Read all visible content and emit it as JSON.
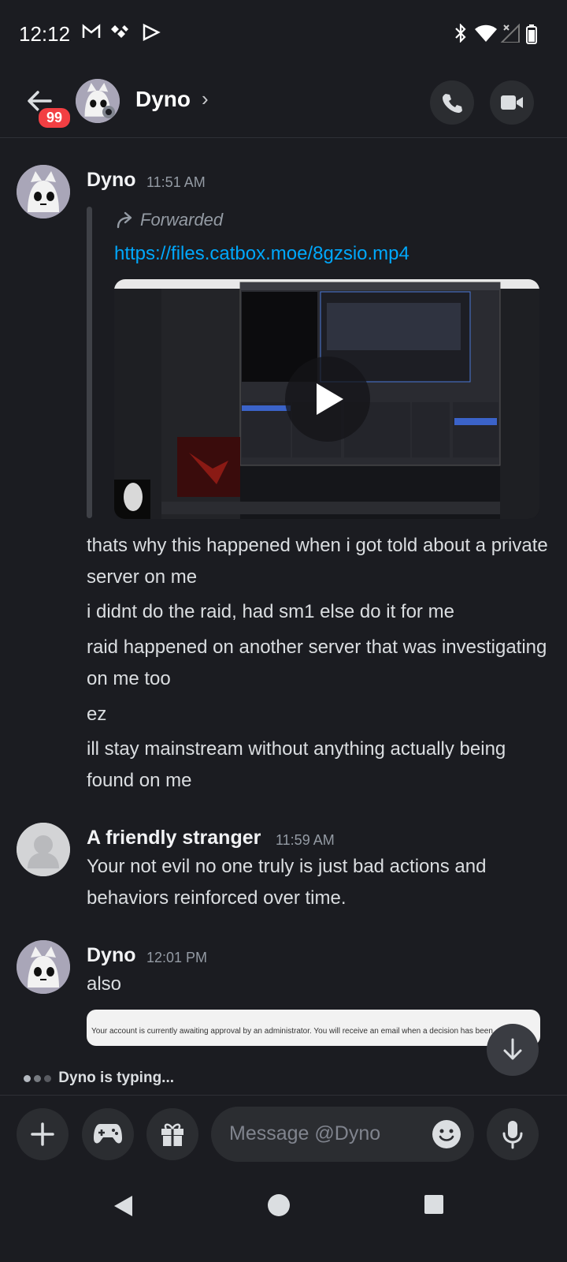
{
  "status_bar": {
    "time": "12:12"
  },
  "header": {
    "badge_count": "99",
    "name": "Dyno"
  },
  "messages": [
    {
      "author": "Dyno",
      "time": "11:51 AM",
      "forwarded_label": "Forwarded",
      "link": "https://files.catbox.moe/8gzsio.mp4",
      "lines": [
        "thats why this happened when i got told about a private server on me",
        "i didnt do the raid, had sm1 else do it for me",
        "raid happened on another server that was investigating on me too",
        "ez",
        "ill stay mainstream without anything actually being found on me"
      ]
    },
    {
      "author": "A friendly stranger",
      "time": "11:59 AM",
      "lines": [
        "Your not evil no one truly is just bad actions and behaviors reinforced over time."
      ]
    },
    {
      "author": "Dyno",
      "time": "12:01 PM",
      "lines": [
        "also"
      ],
      "embed_text": "Your account is currently awaiting approval by an administrator. You will receive an email when a decision has been"
    }
  ],
  "typing_indicator": "Dyno is typing...",
  "input": {
    "placeholder": "Message @Dyno"
  },
  "icons": [
    "back-arrow-icon",
    "phone-icon",
    "video-camera-icon",
    "plus-icon",
    "gamepad-icon",
    "gift-icon",
    "emoji-icon",
    "microphone-icon",
    "arrow-down-icon",
    "play-icon",
    "forward-icon"
  ],
  "colors": {
    "background": "#1b1c21",
    "link": "#00a8fc",
    "badge": "#f23f43"
  }
}
